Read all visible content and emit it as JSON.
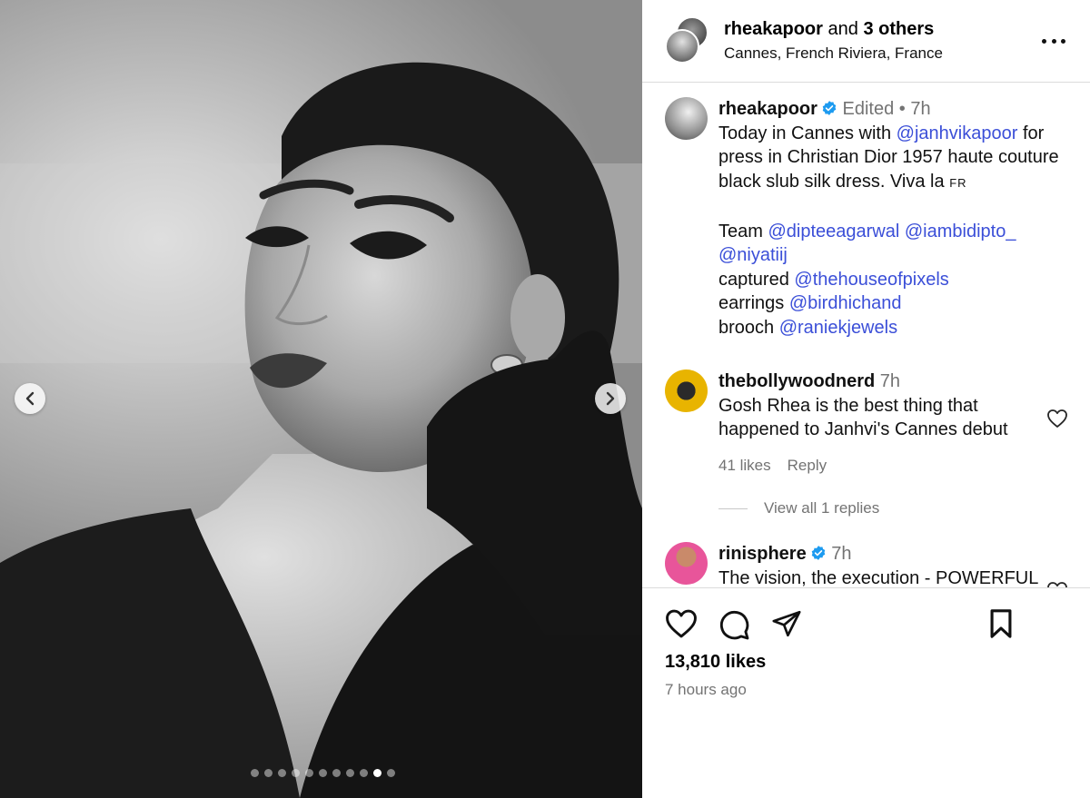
{
  "carousel": {
    "slide_count": 11,
    "active_index": 9,
    "prev_label": "‹",
    "next_label": "›"
  },
  "header": {
    "username": "rheakapoor",
    "joiner": "and",
    "others": "3 others",
    "location": "Cannes, French Riviera, France",
    "more_icon": "more-horizontal-icon"
  },
  "caption": {
    "username": "rheakapoor",
    "edited": "Edited",
    "separator": "•",
    "time": "7h",
    "line1_pre": "Today in Cannes with ",
    "line1_mention": "@janhvikapoor",
    "line1_post": " for press in Christian Dior 1957 haute couture black slub silk dress. Viva la ",
    "flag": "FR",
    "team_label": "Team ",
    "team_mention1": "@dipteeagarwal",
    "team_mention2": "@iambidipto_",
    "team_mention3": "@niyatiij",
    "captured_label": "captured ",
    "captured_mention": "@thehouseofpixels",
    "earrings_label": "earrings ",
    "earrings_mention": "@birdhichand",
    "brooch_label": "brooch ",
    "brooch_mention": "@raniekjewels"
  },
  "comments": [
    {
      "username": "thebollywoodnerd",
      "time": "7h",
      "text": "Gosh Rhea is the best thing that happened to Janhvi's Cannes debut",
      "likes": "41 likes",
      "reply": "Reply",
      "view_replies": "View all 1 replies"
    },
    {
      "username": "rinisphere",
      "time": "7h",
      "text": "The vision, the execution - POWERFUL"
    }
  ],
  "footer": {
    "likes": "13,810 likes",
    "posted": "7 hours ago"
  },
  "colors": {
    "mention": "#3b4fd8",
    "verified": "#1d9bf0",
    "muted": "#737373",
    "divider": "#dbdbdb"
  }
}
